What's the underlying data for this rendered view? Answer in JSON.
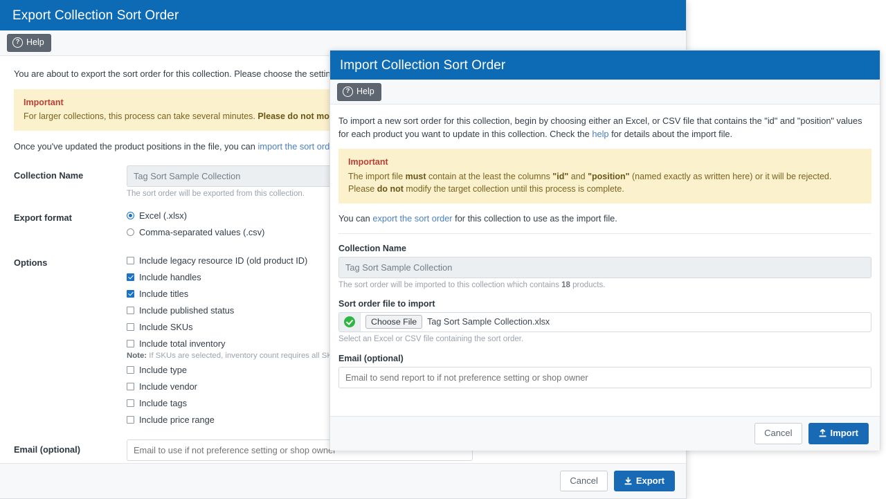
{
  "export_dialog": {
    "title": "Export Collection Sort Order",
    "help_label": "Help",
    "help_icon": "question-circle-icon",
    "intro": "You are about to export the sort order for this collection. Please choose the settings yo",
    "notice": {
      "title": "Important",
      "line1_a": "For larger collections, this process can take several minutes. ",
      "line1_b": "Please do not modify t"
    },
    "after_notice_a": "Once you've updated the product positions in the file, you can ",
    "after_notice_link": "import the sort order",
    "after_notice_b": ".",
    "collection_name_label": "Collection Name",
    "collection_name_value": "Tag Sort Sample Collection",
    "collection_name_hint": "The sort order will be exported from this collection.",
    "export_format_label": "Export format",
    "format_options": [
      {
        "label": "Excel (.xlsx)",
        "selected": true
      },
      {
        "label": "Comma-separated values (.csv)",
        "selected": false
      }
    ],
    "options_label": "Options",
    "options": [
      {
        "label": "Include legacy resource ID (old product ID)",
        "checked": false
      },
      {
        "label": "Include handles",
        "checked": true
      },
      {
        "label": "Include titles",
        "checked": true
      },
      {
        "label": "Include published status",
        "checked": false
      },
      {
        "label": "Include SKUs",
        "checked": false
      },
      {
        "label": "Include total inventory",
        "checked": false
      },
      {
        "label": "Include type",
        "checked": false
      },
      {
        "label": "Include vendor",
        "checked": false
      },
      {
        "label": "Include tags",
        "checked": false
      },
      {
        "label": "Include price range",
        "checked": false
      }
    ],
    "inventory_note_prefix": "Note:",
    "inventory_note": " If SKUs are selected, inventory count requires all SKUs to",
    "email_label": "Email (optional)",
    "email_placeholder": "Email to use if not preference setting or shop owner",
    "email_value": "",
    "cancel_label": "Cancel",
    "submit_label": "Export",
    "submit_icon": "download-arrow-icon"
  },
  "import_dialog": {
    "title": "Import Collection Sort Order",
    "help_label": "Help",
    "help_icon": "question-circle-icon",
    "intro_a": "To import a new sort order for this collection, begin by choosing either an Excel, or CSV file that contains the \"id\" and \"position\" values for each product you want to update in this collection. Check the ",
    "intro_link": "help",
    "intro_b": " for details about the import file.",
    "notice": {
      "title": "Important",
      "l1_a": "The import file ",
      "l1_must": "must",
      "l1_b": " contain at the least the columns ",
      "l1_id": "\"id\"",
      "l1_c": " and ",
      "l1_pos": "\"position\"",
      "l1_d": " (named exactly as written here) or it will be rejected.",
      "l2_a": "Please ",
      "l2_donot": "do not",
      "l2_b": " modify the target collection until this process is complete."
    },
    "export_line_a": "You can ",
    "export_line_link": "export the sort order",
    "export_line_b": " for this collection to use as the import file.",
    "collection_name_label": "Collection Name",
    "collection_name_value": "Tag Sort Sample Collection",
    "collection_name_hint_a": "The sort order will be imported to this collection which contains ",
    "collection_name_hint_count": "18",
    "collection_name_hint_b": " products.",
    "file_label": "Sort order file to import",
    "file_valid_icon": "check-circle-icon",
    "choose_file_label": "Choose File",
    "file_name": "Tag Sort Sample Collection.xlsx",
    "file_hint": "Select an Excel or CSV file containing the sort order.",
    "email_label": "Email (optional)",
    "email_placeholder": "Email to send report to if not preference setting or shop owner",
    "email_value": "",
    "cancel_label": "Cancel",
    "submit_label": "Import",
    "submit_icon": "upload-arrow-icon"
  },
  "colors": {
    "header_blue": "#0d6ab4",
    "primary_blue": "#186ab4",
    "notice_bg": "#fcf1cd",
    "notice_title_red": "#b93f35",
    "help_grey": "#5d6671",
    "valid_green": "#2db742"
  }
}
